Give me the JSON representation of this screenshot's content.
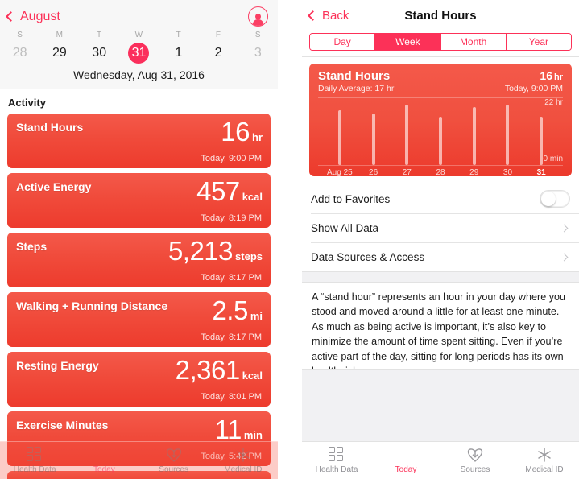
{
  "left_panel": {
    "calendar": {
      "back_label": "August",
      "avatar_icon": "profile-icon",
      "weekday_initials": [
        "S",
        "M",
        "T",
        "W",
        "T",
        "F",
        "S"
      ],
      "dates": [
        {
          "num": "28",
          "state": "dim"
        },
        {
          "num": "29",
          "state": "normal"
        },
        {
          "num": "30",
          "state": "normal"
        },
        {
          "num": "31",
          "state": "selected"
        },
        {
          "num": "1",
          "state": "normal"
        },
        {
          "num": "2",
          "state": "normal"
        },
        {
          "num": "3",
          "state": "dim"
        }
      ],
      "full_date": "Wednesday, Aug 31, 2016"
    },
    "section_title": "Activity",
    "cards": [
      {
        "name": "Stand Hours",
        "value": "16",
        "unit": "hr",
        "time": "Today, 9:00 PM"
      },
      {
        "name": "Active Energy",
        "value": "457",
        "unit": "kcal",
        "time": "Today, 8:19 PM"
      },
      {
        "name": "Steps",
        "value": "5,213",
        "unit": "steps",
        "time": "Today, 8:17 PM"
      },
      {
        "name": "Walking + Running Distance",
        "value": "2.5",
        "unit": "mi",
        "time": "Today, 8:17 PM"
      },
      {
        "name": "Resting Energy",
        "value": "2,361",
        "unit": "kcal",
        "time": "Today, 8:01 PM"
      },
      {
        "name": "Exercise Minutes",
        "value": "11",
        "unit": "min",
        "time": "Today, 5:42 PM"
      }
    ],
    "tabbar": [
      {
        "label": "Health Data",
        "icon": "grid-icon",
        "active": false
      },
      {
        "label": "Today",
        "icon": "calendar-icon",
        "active": true
      },
      {
        "label": "Sources",
        "icon": "download-heart-icon",
        "active": false
      },
      {
        "label": "Medical ID",
        "icon": "asterisk-icon",
        "active": false
      }
    ]
  },
  "right_panel": {
    "nav": {
      "back_label": "Back",
      "title": "Stand Hours"
    },
    "segments": [
      {
        "label": "Day",
        "selected": false
      },
      {
        "label": "Week",
        "selected": true
      },
      {
        "label": "Month",
        "selected": false
      },
      {
        "label": "Year",
        "selected": false
      }
    ],
    "chart_header": {
      "title": "Stand Hours",
      "subtitle": "Daily Average: 17 hr",
      "value": "16",
      "unit": "hr",
      "time": "Today, 9:00 PM"
    },
    "rows": [
      {
        "label": "Add to Favorites",
        "control": "toggle",
        "toggle_on": false
      },
      {
        "label": "Show All Data",
        "control": "chevron"
      },
      {
        "label": "Data Sources & Access",
        "control": "chevron"
      }
    ],
    "description": "A “stand hour” represents an hour in your day where you stood and moved around a little for at least one minute. As much as being active is important, it’s also key to minimize the amount of time spent sitting. Even if you’re active part of the day, sitting for long periods has its own health risks.",
    "tabbar": [
      {
        "label": "Health Data",
        "icon": "grid-icon",
        "active": false
      },
      {
        "label": "Today",
        "icon": "calendar-icon",
        "active": true
      },
      {
        "label": "Sources",
        "icon": "download-heart-icon",
        "active": false
      },
      {
        "label": "Medical ID",
        "icon": "asterisk-icon",
        "active": false
      }
    ]
  },
  "chart_data": {
    "type": "bar",
    "title": "Stand Hours",
    "subtitle": "Daily Average: 17 hr",
    "xlabel": "",
    "ylabel": "Stand Hours",
    "categories": [
      "Aug 25",
      "26",
      "27",
      "28",
      "29",
      "30",
      "31"
    ],
    "values": [
      18,
      17,
      20,
      16,
      19,
      20,
      16
    ],
    "unit": "hr",
    "ylim": [
      0,
      22
    ],
    "y_tick_labels": [
      "22 hr",
      "0 min"
    ],
    "highlight_category": "31",
    "grid": false,
    "legend": "none"
  }
}
